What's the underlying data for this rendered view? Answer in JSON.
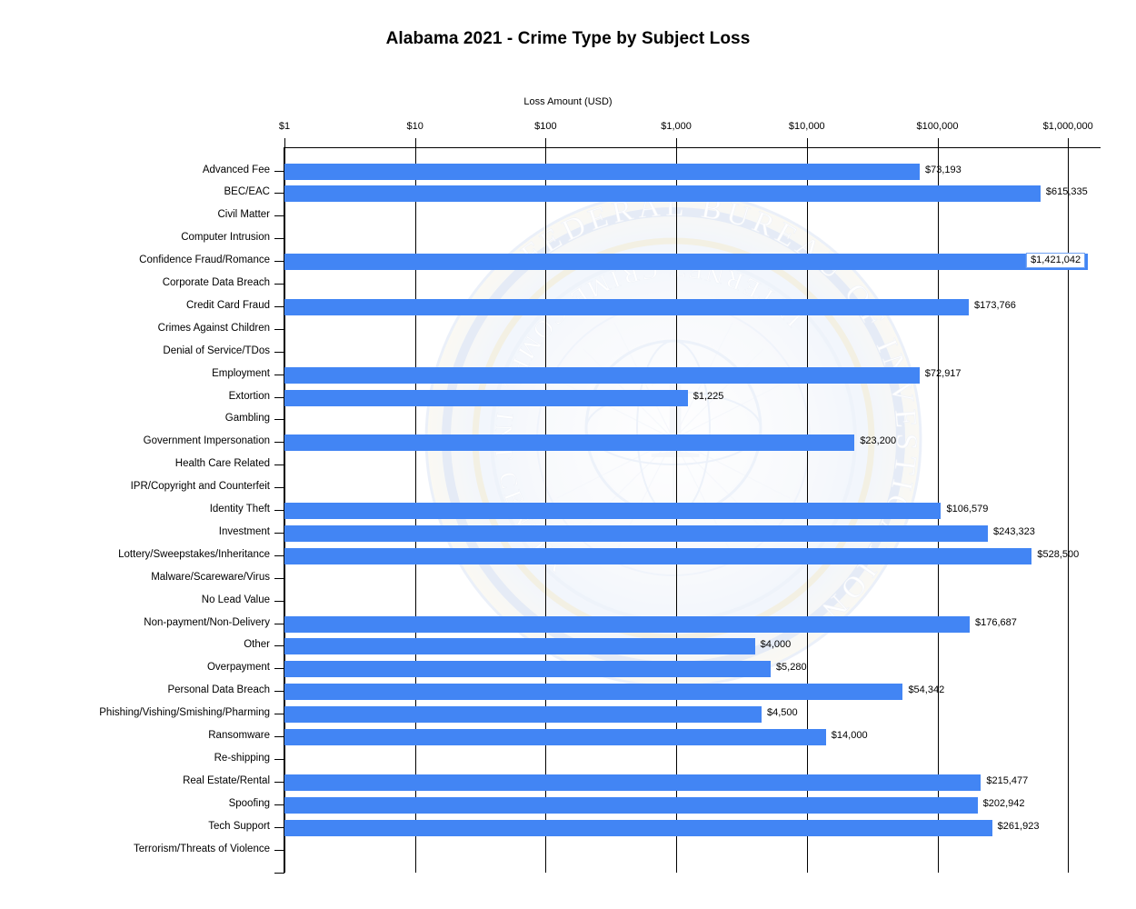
{
  "chart_data": {
    "type": "bar",
    "orientation": "horizontal",
    "title": "Alabama 2021 - Crime Type by Subject Loss",
    "xlabel": "Loss Amount (USD)",
    "ylabel": "",
    "xscale": "log",
    "xlim": [
      1,
      1000000
    ],
    "xtick_labels": [
      "$1",
      "$10",
      "$100",
      "$1,000",
      "$10,000",
      "$100,000",
      "$1,000,000"
    ],
    "xtick_values": [
      1,
      10,
      100,
      1000,
      10000,
      100000,
      1000000
    ],
    "grid": true,
    "legend": null,
    "bar_color": "#4285f4",
    "watermark": {
      "outer_text": "FEDERAL BUREAU OF INVESTIGATION",
      "inner_text": "INTERNET CRIME COMPLAINT CENTER",
      "name": "fbi-ic3-seal"
    },
    "categories": [
      "Advanced Fee",
      "BEC/EAC",
      "Civil Matter",
      "Computer Intrusion",
      "Confidence Fraud/Romance",
      "Corporate Data Breach",
      "Credit Card Fraud",
      "Crimes Against Children",
      "Denial of Service/TDos",
      "Employment",
      "Extortion",
      "Gambling",
      "Government Impersonation",
      "Health Care Related",
      "IPR/Copyright and Counterfeit",
      "Identity Theft",
      "Investment",
      "Lottery/Sweepstakes/Inheritance",
      "Malware/Scareware/Virus",
      "No Lead Value",
      "Non-payment/Non-Delivery",
      "Other",
      "Overpayment",
      "Personal Data Breach",
      "Phishing/Vishing/Smishing/Pharming",
      "Ransomware",
      "Re-shipping",
      "Real Estate/Rental",
      "Spoofing",
      "Tech Support",
      "Terrorism/Threats of Violence"
    ],
    "values": [
      73193,
      615335,
      0,
      0,
      1421042,
      0,
      173766,
      0,
      0,
      72917,
      1225,
      0,
      23200,
      0,
      0,
      106579,
      243323,
      528500,
      0,
      0,
      176687,
      4000,
      5280,
      54342,
      4500,
      14000,
      0,
      215477,
      202942,
      261923,
      0
    ],
    "value_labels": [
      "$73,193",
      "$615,335",
      "",
      "",
      "$1,421,042",
      "",
      "$173,766",
      "",
      "",
      "$72,917",
      "$1,225",
      "",
      "$23,200",
      "",
      "",
      "$106,579",
      "$243,323",
      "$528,500",
      "",
      "",
      "$176,687",
      "$4,000",
      "$5,280",
      "$54,342",
      "$4,500",
      "$14,000",
      "",
      "$215,477",
      "$202,942",
      "$261,923",
      ""
    ]
  }
}
